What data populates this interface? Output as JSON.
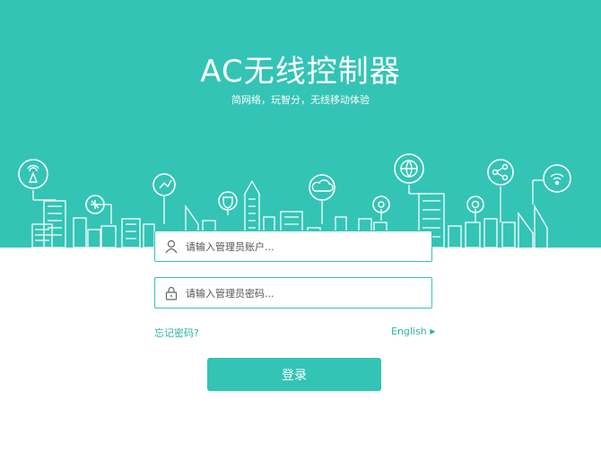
{
  "header": {
    "title": "AC无线控制器",
    "subtitle": "简网络，玩智分，无线移动体验"
  },
  "form": {
    "username_placeholder": "请输入管理员账户...",
    "password_placeholder": "请输入管理员密码...",
    "forgot_password": "忘记密码?",
    "language": "English",
    "login_label": "登录"
  },
  "colors": {
    "accent": "#33c4b5",
    "link": "#2fb3a5"
  },
  "icons": [
    "antenna-icon",
    "share-icon",
    "connect-icon",
    "shield-icon",
    "cloud-icon",
    "globe-icon",
    "at-icon",
    "gear-icon",
    "share-icon",
    "wifi-icon",
    "user-icon",
    "lock-icon"
  ]
}
